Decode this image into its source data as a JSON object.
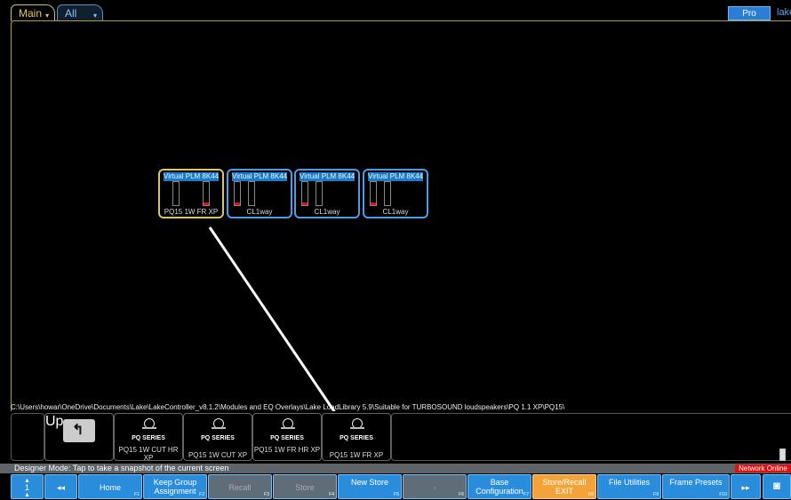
{
  "tabs": [
    {
      "label": "Main",
      "selected": true
    },
    {
      "label": "All",
      "selected": false
    }
  ],
  "header": {
    "pro_button": "Pro",
    "logo_text": "lake"
  },
  "devices": [
    {
      "title": "Virtual PLM 8K44",
      "label": "PQ15 1W FR XP",
      "selected": true
    },
    {
      "title": "Virtual PLM 8K44",
      "label": "CL1way",
      "selected": false
    },
    {
      "title": "Virtual PLM 8K44",
      "label": "CL1way",
      "selected": false
    },
    {
      "title": "Virtual PLM 8K44",
      "label": "CL1way",
      "selected": false
    }
  ],
  "path": "C:\\Users\\howar\\OneDrive\\Documents\\Lake\\LakeController_v8.1.2\\Modules and EQ Overlays\\Lake LoadLibrary 5.9\\Suitable for TURBOSOUND loudspeakers\\PQ 1.1 XP\\PQ15\\",
  "library": {
    "up_label": "Up",
    "items": [
      {
        "series": "PQ SERIES",
        "label": "PQ15 1W CUT HR XP"
      },
      {
        "series": "PQ SERIES",
        "label": "PQ15 1W CUT XP"
      },
      {
        "series": "PQ SERIES",
        "label": "PQ15 1W FR HR XP"
      },
      {
        "series": "PQ SERIES",
        "label": "PQ15 1W FR XP"
      }
    ]
  },
  "status": {
    "message": "Designer Mode: Tap to take a snapshot of the current screen",
    "network": "Network Online"
  },
  "toolbar": [
    {
      "label": "1",
      "fkey": "",
      "state": "active"
    },
    {
      "label": "◂◂",
      "fkey": "",
      "state": "active"
    },
    {
      "label": "Home",
      "fkey": "F1",
      "state": "active"
    },
    {
      "label": "Keep Group Assignment",
      "fkey": "F2",
      "state": "active"
    },
    {
      "label": "Recall",
      "fkey": "F3",
      "state": "disabled"
    },
    {
      "label": "Store",
      "fkey": "F4",
      "state": "disabled"
    },
    {
      "label": "New Store",
      "fkey": "F5",
      "state": "active"
    },
    {
      "label": "-",
      "fkey": "F6",
      "state": "disabled"
    },
    {
      "label": "Base Configuration",
      "fkey": "F7",
      "state": "active"
    },
    {
      "label": "Store/Recall EXIT",
      "fkey": "F8",
      "state": "orange"
    },
    {
      "label": "File Utilities",
      "fkey": "F9",
      "state": "active"
    },
    {
      "label": "Frame Presets",
      "fkey": "F10",
      "state": "active"
    },
    {
      "label": "▸▸",
      "fkey": "",
      "state": "active"
    }
  ],
  "colors": {
    "accent": "#2a8ddc",
    "selected_outline": "#d9c46a",
    "network_alert": "#e01010"
  }
}
